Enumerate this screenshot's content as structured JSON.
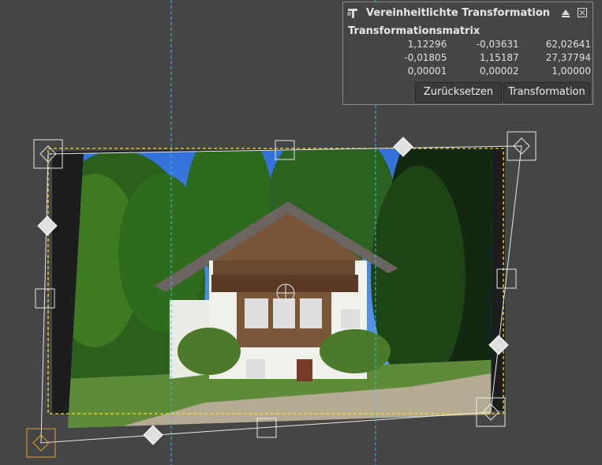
{
  "dialog": {
    "title": "Vereinheitlichte Transformation",
    "subtitle": "Transformationsmatrix",
    "matrix": [
      [
        "1,12296",
        "-0,03631",
        "62,02641"
      ],
      [
        "-0,01805",
        "1,15187",
        "27,37794"
      ],
      [
        "0,00001",
        "0,00002",
        "1,00000"
      ]
    ],
    "reset_label": "Zurücksetzen",
    "transform_label": "Transformation",
    "icons": {
      "tool": "transform-tool-icon",
      "detach": "detach-icon",
      "close": "close-icon"
    }
  },
  "colors": {
    "background": "#454545",
    "guide": "#2cc6d8",
    "selection": "#f0e020",
    "handle": "#ffffff",
    "active_handle": "#e6a020"
  }
}
